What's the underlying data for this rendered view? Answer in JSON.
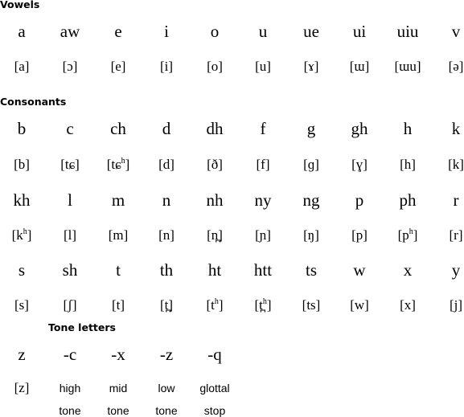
{
  "sections": {
    "vowels": {
      "title": "Vowels",
      "letters": [
        "a",
        "aw",
        "e",
        "i",
        "o",
        "u",
        "ue",
        "ui",
        "uiu",
        "v"
      ],
      "ipa": [
        "[a]",
        "[ɔ]",
        "[e]",
        "[i]",
        "[o]",
        "[u]",
        "[ɤ]",
        "[ɯ]",
        "[ɯu]",
        "[ə]"
      ]
    },
    "consonants": {
      "title": "Consonants",
      "rows": [
        {
          "letters": [
            "b",
            "c",
            "ch",
            "d",
            "dh",
            "f",
            "g",
            "gh",
            "h",
            "k"
          ],
          "ipa": [
            "[b]",
            "[tɕ]",
            "[tɕʰ]",
            "[d]",
            "[ð]",
            "[f]",
            "[ɡ]",
            "[ɣ]",
            "[h]",
            "[k]"
          ]
        },
        {
          "letters": [
            "kh",
            "l",
            "m",
            "n",
            "nh",
            "ny",
            "ng",
            "p",
            "ph",
            "r"
          ],
          "ipa": [
            "[kʰ]",
            "[l]",
            "[m]",
            "[n]",
            "[n̪]",
            "[ɲ]",
            "[ŋ]",
            "[p]",
            "[pʰ]",
            "[r]"
          ]
        },
        {
          "letters": [
            "s",
            "sh",
            "t",
            "th",
            "ht",
            "htt",
            "ts",
            "w",
            "x",
            "y"
          ],
          "ipa": [
            "[s]",
            "[ʃ]",
            "[t]",
            "[t̪]",
            "[tʰ]",
            "[t̪ʰ]",
            "[ts]",
            "[w]",
            "[x]",
            "[j]"
          ]
        },
        {
          "letters": [
            "z"
          ],
          "ipa": [
            "[z]"
          ]
        }
      ]
    },
    "tone_letters": {
      "title": "Tone letters",
      "items": [
        {
          "letter": "-c",
          "line1": "high",
          "line2": "tone"
        },
        {
          "letter": "-x",
          "line1": "mid",
          "line2": "tone"
        },
        {
          "letter": "-z",
          "line1": "low",
          "line2": "tone"
        },
        {
          "letter": "-q",
          "line1": "glottal",
          "line2": "stop"
        }
      ]
    }
  }
}
